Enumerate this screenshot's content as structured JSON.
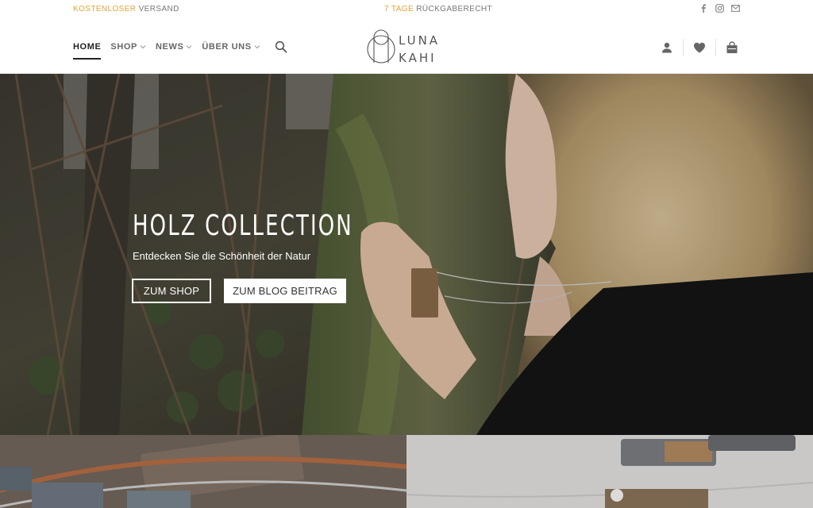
{
  "topbar": {
    "shipping_accent": "KOSTENLOSER",
    "shipping_rest": "VERSAND",
    "returns_accent": "7 TAGE",
    "returns_rest": "RÜCKGABERECHT",
    "social_icons": [
      "facebook-icon",
      "instagram-icon",
      "mail-icon"
    ]
  },
  "nav": {
    "items": [
      {
        "label": "HOME",
        "active": true
      },
      {
        "label": "SHOP"
      },
      {
        "label": "NEWS"
      },
      {
        "label": "ÜBER UNS"
      }
    ]
  },
  "logo": {
    "line1": "LUNA",
    "line2": "KAHI"
  },
  "hero": {
    "title": "HOLZ COLLECTION",
    "subtitle": "Entdecken Sie die Schönheit der Natur",
    "button_shop": "ZUM SHOP",
    "button_blog": "ZUM BLOG BEITRAG"
  },
  "colors": {
    "accent": "#e0a43a",
    "text": "#333333"
  }
}
